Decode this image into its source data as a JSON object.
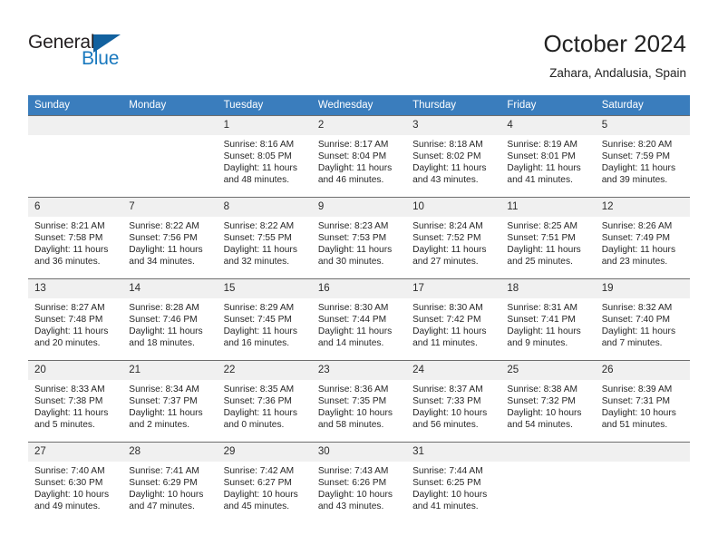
{
  "brand": {
    "name_part1": "General",
    "name_part2": "Blue",
    "triangle_color": "#12619f",
    "blue_color": "#1878be"
  },
  "header": {
    "title": "October 2024",
    "subtitle": "Zahara, Andalusia, Spain"
  },
  "theme": {
    "header_row_bg": "#3a7dbd",
    "daynum_bg": "#f0f0f0",
    "row_divider": "#6e6e6e",
    "text": "#262626"
  },
  "labels": {
    "sunrise_prefix": "Sunrise:",
    "sunset_prefix": "Sunset:",
    "daylight_prefix": "Daylight:"
  },
  "weekday_headers": [
    "Sunday",
    "Monday",
    "Tuesday",
    "Wednesday",
    "Thursday",
    "Friday",
    "Saturday"
  ],
  "weeks": [
    [
      {
        "day": "",
        "sunrise": "",
        "sunset": "",
        "daylight_line1": "",
        "daylight_line2": "",
        "blank": true
      },
      {
        "day": "",
        "sunrise": "",
        "sunset": "",
        "daylight_line1": "",
        "daylight_line2": "",
        "blank": true
      },
      {
        "day": "1",
        "sunrise": "Sunrise: 8:16 AM",
        "sunset": "Sunset: 8:05 PM",
        "daylight_line1": "Daylight: 11 hours",
        "daylight_line2": "and 48 minutes."
      },
      {
        "day": "2",
        "sunrise": "Sunrise: 8:17 AM",
        "sunset": "Sunset: 8:04 PM",
        "daylight_line1": "Daylight: 11 hours",
        "daylight_line2": "and 46 minutes."
      },
      {
        "day": "3",
        "sunrise": "Sunrise: 8:18 AM",
        "sunset": "Sunset: 8:02 PM",
        "daylight_line1": "Daylight: 11 hours",
        "daylight_line2": "and 43 minutes."
      },
      {
        "day": "4",
        "sunrise": "Sunrise: 8:19 AM",
        "sunset": "Sunset: 8:01 PM",
        "daylight_line1": "Daylight: 11 hours",
        "daylight_line2": "and 41 minutes."
      },
      {
        "day": "5",
        "sunrise": "Sunrise: 8:20 AM",
        "sunset": "Sunset: 7:59 PM",
        "daylight_line1": "Daylight: 11 hours",
        "daylight_line2": "and 39 minutes."
      }
    ],
    [
      {
        "day": "6",
        "sunrise": "Sunrise: 8:21 AM",
        "sunset": "Sunset: 7:58 PM",
        "daylight_line1": "Daylight: 11 hours",
        "daylight_line2": "and 36 minutes."
      },
      {
        "day": "7",
        "sunrise": "Sunrise: 8:22 AM",
        "sunset": "Sunset: 7:56 PM",
        "daylight_line1": "Daylight: 11 hours",
        "daylight_line2": "and 34 minutes."
      },
      {
        "day": "8",
        "sunrise": "Sunrise: 8:22 AM",
        "sunset": "Sunset: 7:55 PM",
        "daylight_line1": "Daylight: 11 hours",
        "daylight_line2": "and 32 minutes."
      },
      {
        "day": "9",
        "sunrise": "Sunrise: 8:23 AM",
        "sunset": "Sunset: 7:53 PM",
        "daylight_line1": "Daylight: 11 hours",
        "daylight_line2": "and 30 minutes."
      },
      {
        "day": "10",
        "sunrise": "Sunrise: 8:24 AM",
        "sunset": "Sunset: 7:52 PM",
        "daylight_line1": "Daylight: 11 hours",
        "daylight_line2": "and 27 minutes."
      },
      {
        "day": "11",
        "sunrise": "Sunrise: 8:25 AM",
        "sunset": "Sunset: 7:51 PM",
        "daylight_line1": "Daylight: 11 hours",
        "daylight_line2": "and 25 minutes."
      },
      {
        "day": "12",
        "sunrise": "Sunrise: 8:26 AM",
        "sunset": "Sunset: 7:49 PM",
        "daylight_line1": "Daylight: 11 hours",
        "daylight_line2": "and 23 minutes."
      }
    ],
    [
      {
        "day": "13",
        "sunrise": "Sunrise: 8:27 AM",
        "sunset": "Sunset: 7:48 PM",
        "daylight_line1": "Daylight: 11 hours",
        "daylight_line2": "and 20 minutes."
      },
      {
        "day": "14",
        "sunrise": "Sunrise: 8:28 AM",
        "sunset": "Sunset: 7:46 PM",
        "daylight_line1": "Daylight: 11 hours",
        "daylight_line2": "and 18 minutes."
      },
      {
        "day": "15",
        "sunrise": "Sunrise: 8:29 AM",
        "sunset": "Sunset: 7:45 PM",
        "daylight_line1": "Daylight: 11 hours",
        "daylight_line2": "and 16 minutes."
      },
      {
        "day": "16",
        "sunrise": "Sunrise: 8:30 AM",
        "sunset": "Sunset: 7:44 PM",
        "daylight_line1": "Daylight: 11 hours",
        "daylight_line2": "and 14 minutes."
      },
      {
        "day": "17",
        "sunrise": "Sunrise: 8:30 AM",
        "sunset": "Sunset: 7:42 PM",
        "daylight_line1": "Daylight: 11 hours",
        "daylight_line2": "and 11 minutes."
      },
      {
        "day": "18",
        "sunrise": "Sunrise: 8:31 AM",
        "sunset": "Sunset: 7:41 PM",
        "daylight_line1": "Daylight: 11 hours",
        "daylight_line2": "and 9 minutes."
      },
      {
        "day": "19",
        "sunrise": "Sunrise: 8:32 AM",
        "sunset": "Sunset: 7:40 PM",
        "daylight_line1": "Daylight: 11 hours",
        "daylight_line2": "and 7 minutes."
      }
    ],
    [
      {
        "day": "20",
        "sunrise": "Sunrise: 8:33 AM",
        "sunset": "Sunset: 7:38 PM",
        "daylight_line1": "Daylight: 11 hours",
        "daylight_line2": "and 5 minutes."
      },
      {
        "day": "21",
        "sunrise": "Sunrise: 8:34 AM",
        "sunset": "Sunset: 7:37 PM",
        "daylight_line1": "Daylight: 11 hours",
        "daylight_line2": "and 2 minutes."
      },
      {
        "day": "22",
        "sunrise": "Sunrise: 8:35 AM",
        "sunset": "Sunset: 7:36 PM",
        "daylight_line1": "Daylight: 11 hours",
        "daylight_line2": "and 0 minutes."
      },
      {
        "day": "23",
        "sunrise": "Sunrise: 8:36 AM",
        "sunset": "Sunset: 7:35 PM",
        "daylight_line1": "Daylight: 10 hours",
        "daylight_line2": "and 58 minutes."
      },
      {
        "day": "24",
        "sunrise": "Sunrise: 8:37 AM",
        "sunset": "Sunset: 7:33 PM",
        "daylight_line1": "Daylight: 10 hours",
        "daylight_line2": "and 56 minutes."
      },
      {
        "day": "25",
        "sunrise": "Sunrise: 8:38 AM",
        "sunset": "Sunset: 7:32 PM",
        "daylight_line1": "Daylight: 10 hours",
        "daylight_line2": "and 54 minutes."
      },
      {
        "day": "26",
        "sunrise": "Sunrise: 8:39 AM",
        "sunset": "Sunset: 7:31 PM",
        "daylight_line1": "Daylight: 10 hours",
        "daylight_line2": "and 51 minutes."
      }
    ],
    [
      {
        "day": "27",
        "sunrise": "Sunrise: 7:40 AM",
        "sunset": "Sunset: 6:30 PM",
        "daylight_line1": "Daylight: 10 hours",
        "daylight_line2": "and 49 minutes."
      },
      {
        "day": "28",
        "sunrise": "Sunrise: 7:41 AM",
        "sunset": "Sunset: 6:29 PM",
        "daylight_line1": "Daylight: 10 hours",
        "daylight_line2": "and 47 minutes."
      },
      {
        "day": "29",
        "sunrise": "Sunrise: 7:42 AM",
        "sunset": "Sunset: 6:27 PM",
        "daylight_line1": "Daylight: 10 hours",
        "daylight_line2": "and 45 minutes."
      },
      {
        "day": "30",
        "sunrise": "Sunrise: 7:43 AM",
        "sunset": "Sunset: 6:26 PM",
        "daylight_line1": "Daylight: 10 hours",
        "daylight_line2": "and 43 minutes."
      },
      {
        "day": "31",
        "sunrise": "Sunrise: 7:44 AM",
        "sunset": "Sunset: 6:25 PM",
        "daylight_line1": "Daylight: 10 hours",
        "daylight_line2": "and 41 minutes."
      },
      {
        "day": "",
        "sunrise": "",
        "sunset": "",
        "daylight_line1": "",
        "daylight_line2": "",
        "blank": true
      },
      {
        "day": "",
        "sunrise": "",
        "sunset": "",
        "daylight_line1": "",
        "daylight_line2": "",
        "blank": true
      }
    ]
  ]
}
